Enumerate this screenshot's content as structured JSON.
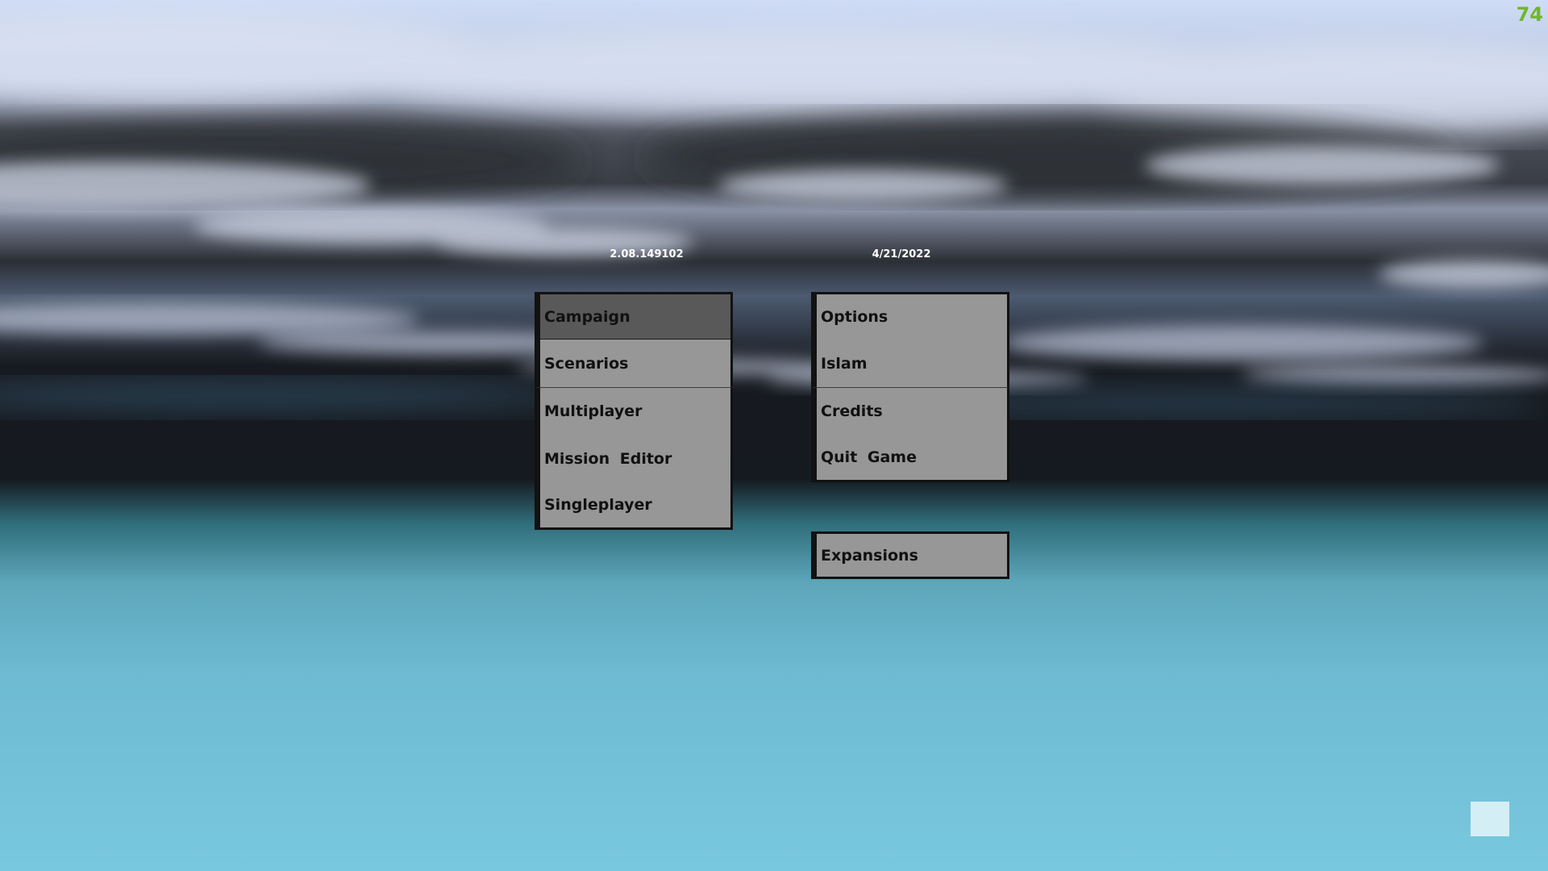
{
  "hud": {
    "fps": "74",
    "version": "2.08.149102",
    "date": "4/21/2022"
  },
  "left_menu": [
    {
      "label": "Campaign",
      "selected": true
    },
    {
      "label": "Scenarios",
      "selected": false
    },
    {
      "label": "Multiplayer",
      "selected": false
    },
    {
      "label": "Mission Editor",
      "selected": false
    },
    {
      "label": "Singleplayer",
      "selected": false
    }
  ],
  "right_menu": [
    {
      "label": "Options"
    },
    {
      "label": "Islam"
    },
    {
      "label": "Credits"
    },
    {
      "label": "Quit Game"
    }
  ],
  "expansions": {
    "label": "Expansions"
  },
  "colors": {
    "button_bg": "#979797",
    "button_selected_bg": "#595959",
    "fps_text": "#6fb82a",
    "sea": "#78c8df"
  }
}
